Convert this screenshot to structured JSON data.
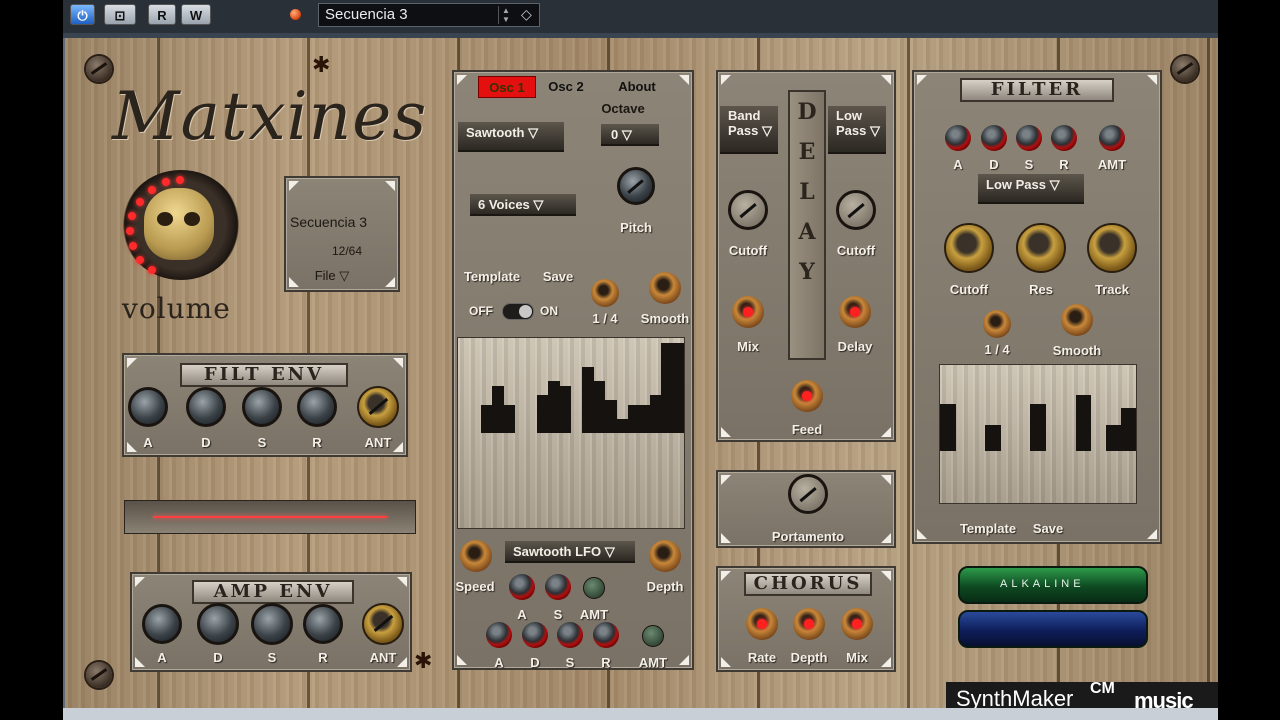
{
  "host": {
    "buttons": [
      {
        "label": "⏻",
        "name": "power-button"
      },
      {
        "label": "⊡",
        "name": "edit-button"
      },
      {
        "label": "R",
        "name": "read-button"
      },
      {
        "label": "W",
        "name": "write-button"
      }
    ],
    "preset_name": "Secuencia 3",
    "accent": "#e0501a"
  },
  "synth": {
    "title": "Matxines",
    "volume_label": "volume",
    "preset_panel": {
      "name": "Secuencia 3",
      "count": "12/64",
      "file_label": "File ▽"
    },
    "filt_env": {
      "title": "FILT ENV",
      "knobs": [
        "A",
        "D",
        "S",
        "R",
        "ANT"
      ]
    },
    "amp_env": {
      "title": "AMP ENV",
      "knobs": [
        "A",
        "D",
        "S",
        "R",
        "ANT"
      ]
    },
    "osc": {
      "tabs": [
        "Osc 1",
        "Osc 2",
        "About"
      ],
      "active_tab": "Osc 1",
      "octave_label": "Octave",
      "octave_value": "0 ▽",
      "waveform": "Sawtooth ▽",
      "voices": "6 Voices ▽",
      "pitch_label": "Pitch",
      "template_label": "Template",
      "save_label": "Save",
      "off_label": "OFF",
      "on_label": "ON",
      "rate_label": "1 / 4",
      "smooth_label": "Smooth",
      "steps": [
        0,
        0,
        0.3,
        0.5,
        0.3,
        0,
        0,
        0.4,
        0.55,
        0.5,
        0,
        0.7,
        0.55,
        0.35,
        0.15,
        0.3,
        0.3,
        0.4,
        0.95,
        0.95
      ]
    },
    "lfo": {
      "waveform": "Sawtooth LFO ▽",
      "speed_label": "Speed",
      "depth_label": "Depth",
      "row1": [
        "A",
        "S",
        "AMT"
      ],
      "row2": [
        "A",
        "D",
        "S",
        "R",
        "AMT"
      ]
    },
    "delay": {
      "title": "DELAY",
      "left_filter": "Band Pass ▽",
      "right_filter": "Low Pass ▽",
      "cutoff_left": "Cutoff",
      "cutoff_right": "Cutoff",
      "mix_label": "Mix",
      "delay_label": "Delay",
      "feed_label": "Feed"
    },
    "portamento_label": "Portamento",
    "chorus": {
      "title": "CHORUS",
      "knobs": [
        "Rate",
        "Depth",
        "Mix"
      ]
    },
    "filter": {
      "title": "FILTER",
      "env_knobs": [
        "A",
        "D",
        "S",
        "R",
        "AMT"
      ],
      "type": "Low Pass ▽",
      "main_knobs": [
        "Cutoff",
        "Res",
        "Track"
      ],
      "rate_label": "1 / 4",
      "smooth_label": "Smooth",
      "template_label": "Template",
      "save_label": "Save",
      "steps": [
        0.55,
        0,
        0,
        0.3,
        0,
        0,
        0.55,
        0,
        0,
        0.65,
        0,
        0.3,
        0.5
      ]
    },
    "battery_label": "ALKALINE",
    "footer": {
      "synthmaker": "SynthMaker",
      "cm": "CM",
      "computer_music": "music"
    }
  }
}
